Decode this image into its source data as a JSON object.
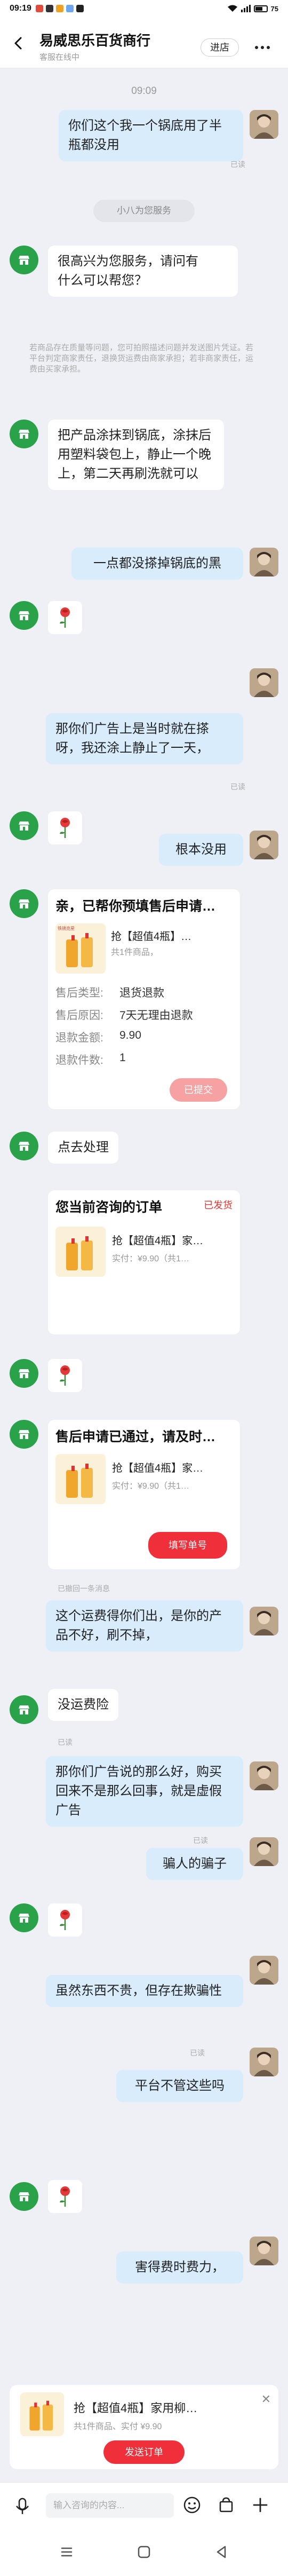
{
  "status_bar": {
    "time": "09:19",
    "battery": "75"
  },
  "header": {
    "shop_name": "易威思乐百货商行",
    "status": "客服在线中",
    "enter_label": "进店"
  },
  "chat": {
    "time": "09:09",
    "m1": "你们这个我一个锅底用了半瓶都没用",
    "read": "已读",
    "sys_pill": "小八为您服务",
    "m2": "您好，很高兴为您服务，请问有什么可以帮您？",
    "m2_l1": "很高兴为您服务，请问有",
    "m2_l2": "什么可以帮您？",
    "notice": "若商品存在质量等问题，您可拍照描述问题并发送图片凭证。若平台判定商家责任，退换货运费由商家承担；若非商家责任，运费由买家承担。",
    "m3": "把产品涂抹到锅底，涂抹后用塑料袋包上，静止一个晚上，第二天再刷洗就可以",
    "m4": "一点都没搽掉锅底的黑",
    "m5": "那你们广告上是当时就在搽呀，我还涂上静止了一天，",
    "m6": "根本没用",
    "m7": "点去处理",
    "m8": "这个运费得你们出，是你的产品不好，刷不掉，",
    "m9": "没运费险",
    "m10": "那你们广告说的那么好，购买回来不是那么回事，就是虚假广告",
    "m11": "骗人的骗子",
    "m12": "虽然东西不贵，但存在欺骗性",
    "m13": "平台不管这些吗",
    "m14": "害得费时费力，",
    "withdrawn": "已撤回一条消息"
  },
  "cards": {
    "refund": {
      "title": "亲，已帮你预填售后申请…",
      "product": "抢【超值4瓶】…",
      "count": "共1件商品，",
      "rows": [
        {
          "label": "售后类型:",
          "value": "退货退款"
        },
        {
          "label": "售后原因:",
          "value": "7天无理由退款"
        },
        {
          "label": "退款金额:",
          "value": "9.90"
        },
        {
          "label": "退款件数:",
          "value": "1"
        }
      ],
      "button": "已提交"
    },
    "order": {
      "title": "您当前咨询的订单",
      "status": "已发货",
      "product": "抢【超值4瓶】家…",
      "price": "实付：¥9.90（共1…"
    },
    "approved": {
      "title": "售后申请已通过，请及时…",
      "product": "抢【超值4瓶】家…",
      "price": "实付：¥9.90（共1…",
      "button": "填写单号"
    }
  },
  "bottom": {
    "product": "抢【超值4瓶】家用柳…",
    "meta": "共1件商品、实付 ¥9.90",
    "send": "发送订单",
    "placeholder": "输入咨询的内容..."
  },
  "thumb_brand": "铁锈克星"
}
